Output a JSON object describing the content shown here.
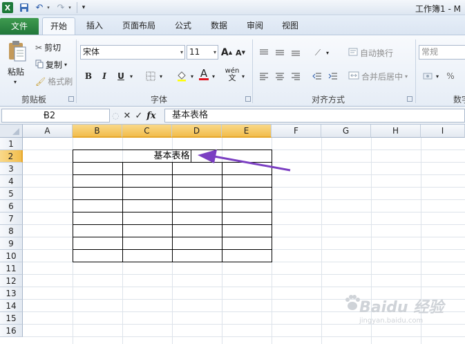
{
  "app": {
    "logo_letter": "X",
    "window_title": "工作簿1 - M"
  },
  "tabs": [
    {
      "label": "文件"
    },
    {
      "label": "开始"
    },
    {
      "label": "插入"
    },
    {
      "label": "页面布局"
    },
    {
      "label": "公式"
    },
    {
      "label": "数据"
    },
    {
      "label": "审阅"
    },
    {
      "label": "视图"
    }
  ],
  "ribbon": {
    "clipboard": {
      "paste": "粘贴",
      "cut": "剪切",
      "copy": "复制",
      "format_painter": "格式刷",
      "label": "剪贴板"
    },
    "font": {
      "font_name": "宋体",
      "font_size": "11",
      "bold": "B",
      "italic": "I",
      "underline": "U",
      "font_color_letter": "A",
      "phonetic": "wén",
      "label": "字体"
    },
    "alignment": {
      "wrap_text": "自动换行",
      "merge_center": "合并后居中",
      "label": "对齐方式"
    },
    "number": {
      "format": "常规",
      "percent": "%",
      "label": "数字"
    }
  },
  "formula_bar": {
    "name_box": "B2",
    "fx": "fx",
    "content": "基本表格"
  },
  "sheet": {
    "columns": [
      "A",
      "B",
      "C",
      "D",
      "E",
      "F",
      "G",
      "H",
      "I"
    ],
    "rows": [
      "1",
      "2",
      "3",
      "4",
      "5",
      "6",
      "7",
      "8",
      "9",
      "10",
      "11",
      "12",
      "13",
      "14",
      "15",
      "16"
    ],
    "selected_cell": "B2",
    "b2_text": "基本表格"
  },
  "watermark": {
    "main": "Baidu 经验",
    "sub": "jingyan.baidu.com"
  },
  "colors": {
    "file_tab": "#2a8a3e",
    "selected_header": "#f5c764",
    "arrow": "#7b3fc2"
  }
}
